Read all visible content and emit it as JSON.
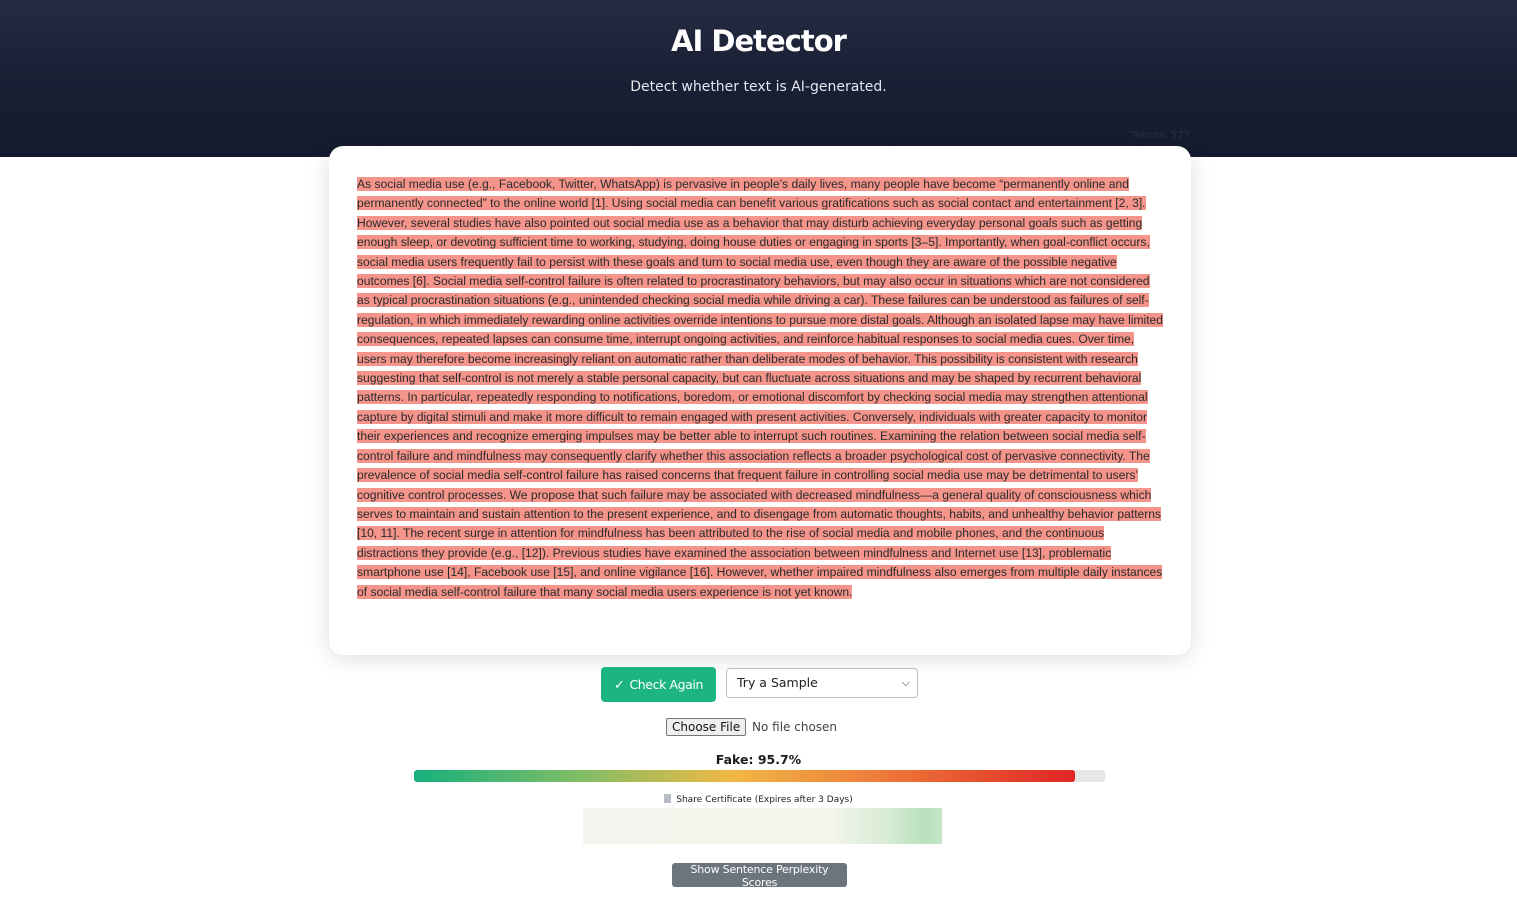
{
  "header": {
    "title": "AI Detector",
    "subtitle": "Detect whether text is AI-generated.",
    "token_count": "Tokens: 577"
  },
  "input": {
    "text": "As social media use (e.g., Facebook, Twitter, WhatsApp) is pervasive in people’s daily lives, many people have become “permanently online and permanently connected” to the online world [1]. Using social media can benefit various gratifications such as social contact and entertainment [2, 3]. However, several studies have also pointed out social media use as a behavior that may disturb achieving everyday personal goals such as getting enough sleep, or devoting sufficient time to working, studying, doing house duties or engaging in sports [3–5]. Importantly, when goal-conflict occurs, social media users frequently fail to persist with these goals and turn to social media use, even though they are aware of the possible negative outcomes [6]. Social media self-control failure is often related to procrastinatory behaviors, but may also occur in situations which are not considered as typical procrastination situations (e.g., unintended checking social media while driving a car). These failures can be understood as failures of self-regulation, in which immediately rewarding online activities override intentions to pursue more distal goals. Although an isolated lapse may have limited consequences, repeated lapses can consume time, interrupt ongoing activities, and reinforce habitual responses to social media cues. Over time, users may therefore become increasingly reliant on automatic rather than deliberate modes of behavior. This possibility is consistent with research suggesting that self-control is not merely a stable personal capacity, but can fluctuate across situations and may be shaped by recurrent behavioral patterns. In particular, repeatedly responding to notifications, boredom, or emotional discomfort by checking social media may strengthen attentional capture by digital stimuli and make it more difficult to remain engaged with present activities. Conversely, individuals with greater capacity to monitor their experiences and recognize emerging impulses may be better able to interrupt such routines. Examining the relation between social media self-control failure and mindfulness may consequently clarify whether this association reflects a broader psychological cost of pervasive connectivity. The prevalence of social media self-control failure has raised concerns that frequent failure in controlling social media use may be detrimental to users’ cognitive control processes. We propose that such failure may be associated with decreased mindfulness—a general quality of consciousness which serves to maintain and sustain attention to the present experience, and to disengage from automatic thoughts, habits, and unhealthy behavior patterns [10, 11]. The recent surge in attention for mindfulness has been attributed to the rise of social media and mobile phones, and the continuous distractions they provide (e.g., [12]). Previous studies have examined the association between mindfulness and Internet use [13], problematic smartphone use [14], Facebook use [15], and online vigilance [16]. However, whether impaired mindfulness also emerges from multiple daily instances of social media self-control failure that many social media users experience is not yet known.",
    "highlight_color": "#f4948b"
  },
  "actions": {
    "check_button_label": "Check Again",
    "check_icon": "check-icon",
    "sample_select": {
      "selected": "Try a Sample",
      "icon": "chevron-down-icon"
    },
    "file": {
      "button_label": "Choose File",
      "status": "No file chosen"
    }
  },
  "result": {
    "fake_label": "Fake: 95.7%",
    "fake_fraction": 0.957,
    "share_label": "Share Certificate (Expires after 3 Days)",
    "perplexity_button_label": "Show Sentence Perplexity Scores"
  },
  "colors": {
    "header_bg": "#1a2035",
    "accent_green": "#1cb580",
    "bar_high": "#e02525",
    "secondary_button": "#6c757d"
  }
}
